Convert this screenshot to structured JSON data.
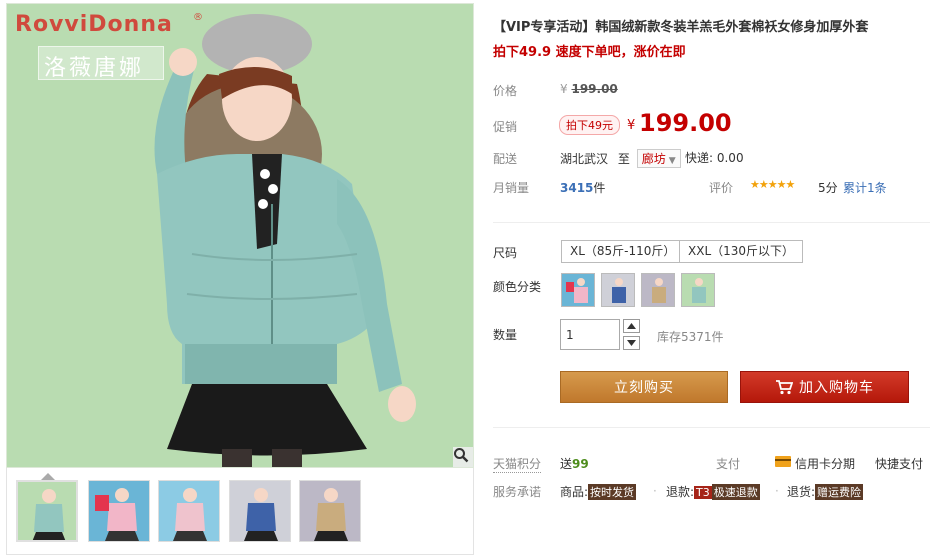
{
  "gallery": {
    "brand_en": "RovviDonna",
    "brand_reg": "®",
    "brand_cn": "洛薇唐娜",
    "zoom_icon": "search-icon",
    "thumbnails": [
      "thumb-mint",
      "thumb-pink-bg-red",
      "thumb-pink",
      "thumb-blue",
      "thumb-khaki"
    ]
  },
  "product": {
    "title": "【VIP专享活动】韩国绒新款冬装羊羔毛外套棉袄女修身加厚外套",
    "subtitle": "拍下49.9 速度下单吧，涨价在即"
  },
  "price": {
    "label": "价格",
    "currency": "¥",
    "original": "199.00",
    "promo_label": "促销",
    "promo_badge": "拍下49元",
    "current": "199.00"
  },
  "shipping": {
    "label": "配送",
    "from": "湖北武汉",
    "to_word": "至",
    "destination": "廊坊",
    "express": "快递: 0.00"
  },
  "sales": {
    "label": "月销量",
    "count": "3415",
    "unit": "件",
    "rating_label": "评价",
    "stars": "★★★★★",
    "score": "5分",
    "reviews": "累计1条"
  },
  "options": {
    "size_label": "尺码",
    "sizes": [
      "XL（85斤-110斤）",
      "XXL（130斤以下）"
    ],
    "color_label": "颜色分类",
    "colors": [
      "rose-red",
      "blue",
      "khaki",
      "mint"
    ],
    "qty_label": "数量",
    "qty_value": "1",
    "stock": "库存5371件"
  },
  "actions": {
    "buy": "立刻购买",
    "cart": "加入购物车",
    "cart_icon": "cart-icon"
  },
  "service": {
    "points_label": "天猫积分",
    "points_prefix": "送",
    "points": "99",
    "pay_label": "支付",
    "installment": "信用卡分期",
    "quickpay": "快捷支付",
    "promise_label": "服务承诺",
    "goods_label": "商品:",
    "goods_tag": "按时发货",
    "refund_label": "退款:",
    "refund_t3": "T3",
    "refund_tag": "极速退款",
    "return_label": "退货:",
    "return_tag": "赠运费险"
  },
  "colors": {
    "accent_red": "#c40000",
    "buy_orange": "#c8853a",
    "cart_red": "#c42313",
    "photo_bg": "#b9dcb1"
  }
}
